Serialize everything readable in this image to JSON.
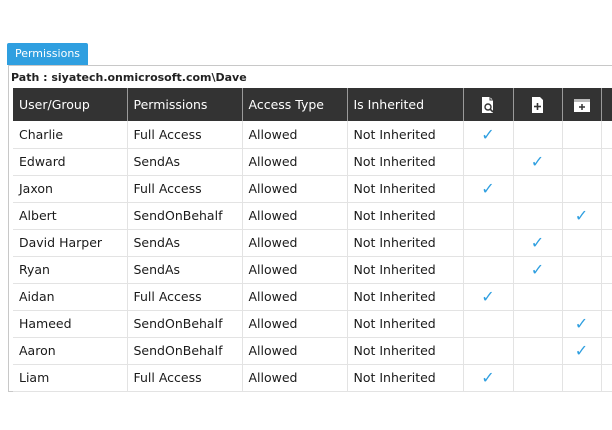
{
  "tab": {
    "label": "Permissions"
  },
  "path": "Path : siyatech.onmicrosoft.com\\Dave",
  "columns": {
    "user": "User/Group",
    "permissions": "Permissions",
    "access": "Access Type",
    "inherited": "Is Inherited"
  },
  "icon_columns": [
    "find-icon",
    "add-document-icon",
    "add-folder-icon"
  ],
  "check_glyph": "✓",
  "accent_color": "#2f9fe0",
  "rows": [
    {
      "user": "Charlie",
      "permission": "Full Access",
      "access": "Allowed",
      "inherited": "Not Inherited",
      "checks": [
        true,
        false,
        false
      ]
    },
    {
      "user": "Edward",
      "permission": "SendAs",
      "access": "Allowed",
      "inherited": "Not Inherited",
      "checks": [
        false,
        true,
        false
      ]
    },
    {
      "user": "Jaxon",
      "permission": "Full Access",
      "access": "Allowed",
      "inherited": "Not Inherited",
      "checks": [
        true,
        false,
        false
      ]
    },
    {
      "user": "Albert",
      "permission": "SendOnBehalf",
      "access": "Allowed",
      "inherited": "Not Inherited",
      "checks": [
        false,
        false,
        true
      ]
    },
    {
      "user": "David Harper",
      "permission": "SendAs",
      "access": "Allowed",
      "inherited": "Not Inherited",
      "checks": [
        false,
        true,
        false
      ]
    },
    {
      "user": "Ryan",
      "permission": "SendAs",
      "access": "Allowed",
      "inherited": "Not Inherited",
      "checks": [
        false,
        true,
        false
      ]
    },
    {
      "user": "Aidan",
      "permission": "Full Access",
      "access": "Allowed",
      "inherited": "Not Inherited",
      "checks": [
        true,
        false,
        false
      ]
    },
    {
      "user": "Hameed",
      "permission": "SendOnBehalf",
      "access": "Allowed",
      "inherited": "Not Inherited",
      "checks": [
        false,
        false,
        true
      ]
    },
    {
      "user": "Aaron",
      "permission": "SendOnBehalf",
      "access": "Allowed",
      "inherited": "Not Inherited",
      "checks": [
        false,
        false,
        true
      ]
    },
    {
      "user": "Liam",
      "permission": "Full Access",
      "access": "Allowed",
      "inherited": "Not Inherited",
      "checks": [
        true,
        false,
        false
      ]
    }
  ]
}
